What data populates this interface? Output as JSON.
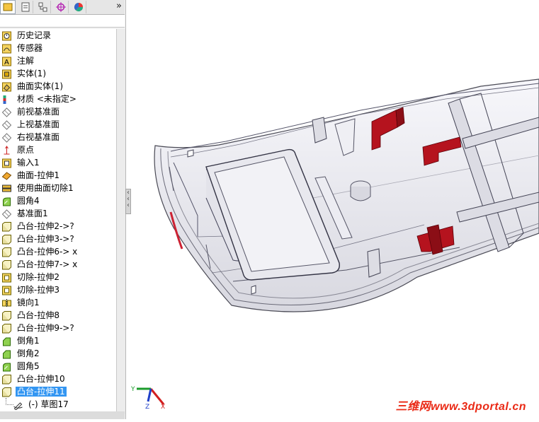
{
  "toolbar": {
    "tabs": [
      {
        "icon": "feature-manager-icon",
        "active": true
      },
      {
        "icon": "property-manager-icon",
        "active": false
      },
      {
        "icon": "configuration-manager-icon",
        "active": false
      },
      {
        "icon": "dimxpert-icon",
        "active": false
      },
      {
        "icon": "display-manager-icon",
        "active": false
      }
    ],
    "expand_label": "»"
  },
  "tree": {
    "items": [
      {
        "label": "历史记录",
        "icon": "history-icon"
      },
      {
        "label": "传感器",
        "icon": "sensor-icon"
      },
      {
        "label": "注解",
        "icon": "annotation-icon"
      },
      {
        "label": "实体(1)",
        "icon": "solid-body-icon"
      },
      {
        "label": "曲面实体(1)",
        "icon": "surface-body-icon"
      },
      {
        "label": "材质 <未指定>",
        "icon": "material-icon"
      },
      {
        "label": "前视基准面",
        "icon": "plane-icon"
      },
      {
        "label": "上视基准面",
        "icon": "plane-icon"
      },
      {
        "label": "右视基准面",
        "icon": "plane-icon"
      },
      {
        "label": "原点",
        "icon": "origin-icon"
      },
      {
        "label": "输入1",
        "icon": "import-icon"
      },
      {
        "label": "曲面-拉伸1",
        "icon": "surface-extrude-icon"
      },
      {
        "label": "使用曲面切除1",
        "icon": "surface-cut-icon"
      },
      {
        "label": "圆角4",
        "icon": "fillet-icon"
      },
      {
        "label": "基准面1",
        "icon": "plane-icon"
      },
      {
        "label": "凸台-拉伸2->?",
        "icon": "boss-extrude-icon"
      },
      {
        "label": "凸台-拉伸3->?",
        "icon": "boss-extrude-icon"
      },
      {
        "label": "凸台-拉伸6-> x",
        "icon": "boss-extrude-icon"
      },
      {
        "label": "凸台-拉伸7-> x",
        "icon": "boss-extrude-icon"
      },
      {
        "label": "切除-拉伸2",
        "icon": "cut-extrude-icon"
      },
      {
        "label": "切除-拉伸3",
        "icon": "cut-extrude-icon"
      },
      {
        "label": "镜向1",
        "icon": "mirror-icon"
      },
      {
        "label": "凸台-拉伸8",
        "icon": "boss-extrude-icon"
      },
      {
        "label": "凸台-拉伸9->?",
        "icon": "boss-extrude-icon"
      },
      {
        "label": "倒角1",
        "icon": "chamfer-icon"
      },
      {
        "label": "倒角2",
        "icon": "chamfer-icon"
      },
      {
        "label": "圆角5",
        "icon": "fillet-icon"
      },
      {
        "label": "凸台-拉伸10",
        "icon": "boss-extrude-icon"
      },
      {
        "label": "凸台-拉伸11",
        "icon": "boss-extrude-icon",
        "selected": true
      },
      {
        "label": "(-) 草图17",
        "icon": "sketch-icon",
        "child": true
      }
    ]
  },
  "triad": {
    "x": "X",
    "y": "Y",
    "z": "Z"
  },
  "watermark": "三维网www.3dportal.cn",
  "colors": {
    "selection": "#3396f2",
    "feature_red": "#b5131e",
    "watermark": "#ea2a16"
  }
}
